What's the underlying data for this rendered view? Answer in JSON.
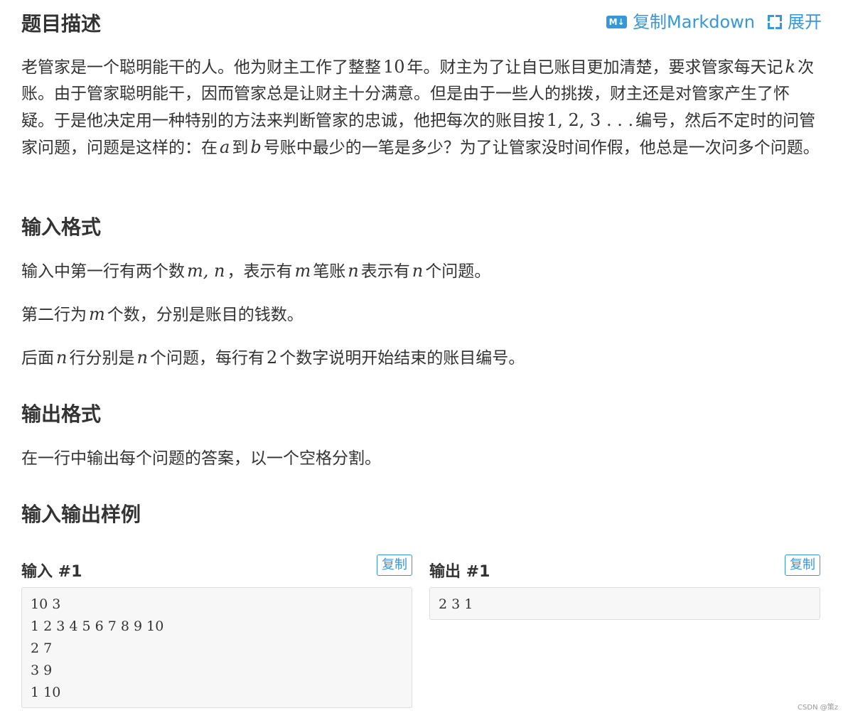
{
  "description": {
    "heading": "题目描述",
    "copy_markdown": "复制Markdown",
    "md_icon": "M↓",
    "expand": "展开",
    "text": [
      {
        "t": "老管家是一个聪明能干的人。他为财主工作了整整"
      },
      {
        "n": "10"
      },
      {
        "t": "年。财主为了让自已账目更加清楚，要求管家每天记"
      },
      {
        "m": "k"
      },
      {
        "t": "次账。由于管家聪明能干，因而管家总是让财主十分满意。但是由于一些人的挑拨，财主还是对管家产生了怀疑。于是他决定用一种特别的方法来判断管家的忠诚，他把每次的账目按"
      },
      {
        "n": "1, 2, 3 . . ."
      },
      {
        "t": "编号，然后不定时的问管家问题，问题是这样的：在"
      },
      {
        "m": "a"
      },
      {
        "t": "到"
      },
      {
        "m": "b"
      },
      {
        "t": "号账中最少的一笔是多少？为了让管家没时间作假，他总是一次问多个问题。"
      }
    ]
  },
  "input_format": {
    "heading": "输入格式",
    "p1": [
      {
        "t": "输入中第一行有两个数"
      },
      {
        "m": "m, n"
      },
      {
        "t": "，表示有"
      },
      {
        "m": "m"
      },
      {
        "t": "笔账"
      },
      {
        "m": "n"
      },
      {
        "t": "表示有"
      },
      {
        "m": "n"
      },
      {
        "t": "个问题。"
      }
    ],
    "p2": [
      {
        "t": "第二行为"
      },
      {
        "m": "m"
      },
      {
        "t": "个数，分别是账目的钱数。"
      }
    ],
    "p3": [
      {
        "t": "后面"
      },
      {
        "m": "n"
      },
      {
        "t": "行分别是"
      },
      {
        "m": "n"
      },
      {
        "t": "个问题，每行有"
      },
      {
        "n": "2"
      },
      {
        "t": "个数字说明开始结束的账目编号。"
      }
    ]
  },
  "output_format": {
    "heading": "输出格式",
    "p1": "在一行中输出每个问题的答案，以一个空格分割。"
  },
  "samples": {
    "heading": "输入输出样例",
    "input_title": "输入 #1",
    "output_title": "输出 #1",
    "copy_label": "复制",
    "input_lines": "10 3\n1 2 3 4 5 6 7 8 9 10\n2 7\n3 9\n1 10",
    "output_lines": "2 3 1"
  },
  "watermark": "CSDN @策z"
}
